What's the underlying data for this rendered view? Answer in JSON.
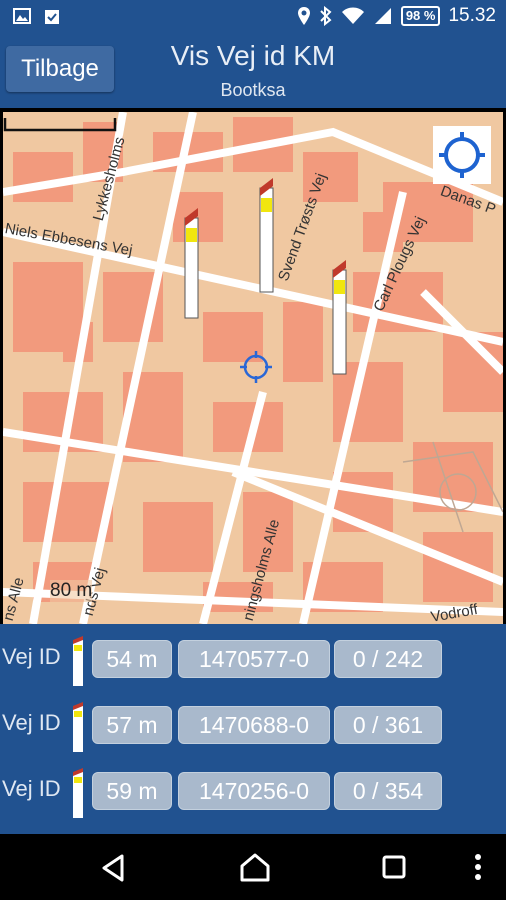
{
  "status_bar": {
    "battery": "98 %",
    "time": "15.32",
    "icons": [
      "image-icon",
      "clipboard-check-icon",
      "location-pin-icon",
      "bluetooth-icon",
      "wifi-icon",
      "signal-icon",
      "battery-icon"
    ]
  },
  "header": {
    "back_label": "Tilbage",
    "title": "Vis Vej id KM",
    "subtitle": "Bootksa"
  },
  "map": {
    "street_labels": [
      "Lykkesholms",
      "Niels Ebbesens Vej",
      "Svend Trøsts Vej",
      "Carl Plougs Vej",
      "Danas P",
      "nds Vej",
      "ningsholms Alle",
      "ns Alle",
      "Vodroff"
    ],
    "scale_label": "80 m",
    "colors": {
      "land": "#f0c8a1",
      "building": "#f29a7d",
      "road": "#ffffff"
    }
  },
  "rows": [
    {
      "label": "Vej ID",
      "distance": "54 m",
      "id": "1470577-0",
      "range": "0 / 242"
    },
    {
      "label": "Vej ID",
      "distance": "57 m",
      "id": "1470688-0",
      "range": "0 / 361"
    },
    {
      "label": "Vej ID",
      "distance": "59 m",
      "id": "1470256-0",
      "range": "0 / 354"
    }
  ],
  "colors": {
    "primary": "#215290",
    "pill": "#a9b9cc"
  }
}
